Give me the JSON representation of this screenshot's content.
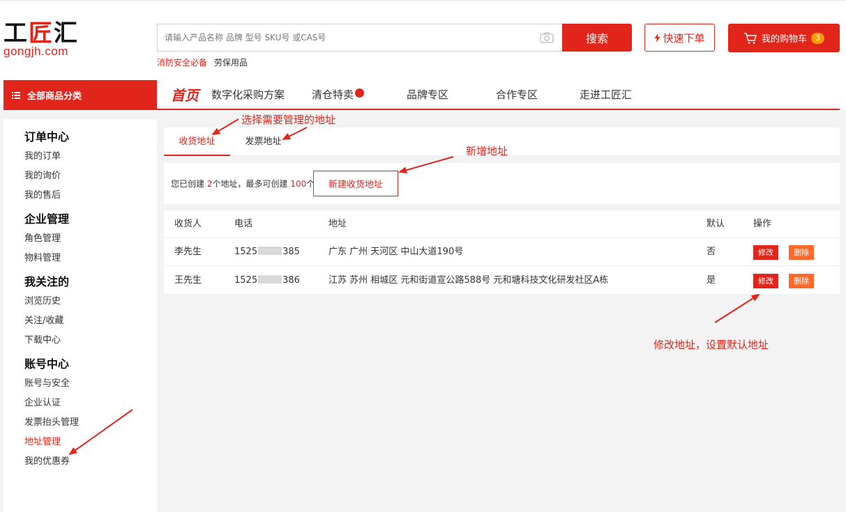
{
  "header": {
    "logo_cn_1": "工",
    "logo_cn_2": "匠",
    "logo_cn_3": "汇",
    "logo_en": "gongjh.com",
    "search_placeholder": "请输入产品名称 品牌 型号 SKU号 或CAS号",
    "search_button": "搜索",
    "quick_order": "快速下单",
    "cart_label": "我的购物车",
    "cart_count": "3",
    "hot_words": [
      "消防安全必备",
      "劳保用品"
    ]
  },
  "nav": {
    "all_categories": "全部商品分类",
    "items": [
      "首页",
      "数字化采购方案",
      "清仓特卖",
      "品牌专区",
      "合作专区",
      "走进工匠汇"
    ]
  },
  "sidebar": {
    "groups": [
      {
        "title": "订单中心",
        "items": [
          "我的订单",
          "我的询价",
          "我的售后"
        ]
      },
      {
        "title": "企业管理",
        "items": [
          "角色管理",
          "物料管理"
        ]
      },
      {
        "title": "我关注的",
        "items": [
          "浏览历史",
          "关注/收藏",
          "下载中心"
        ]
      },
      {
        "title": "账号中心",
        "items": [
          "账号与安全",
          "企业认证",
          "发票抬头管理",
          "地址管理",
          "我的优惠券"
        ]
      }
    ]
  },
  "tabs": [
    "收货地址",
    "发票地址"
  ],
  "info": {
    "prefix": "您已创建",
    "created": "2",
    "middle": "个地址，最多可创建",
    "max": "100",
    "suffix": "个",
    "new_button": "新建收货地址"
  },
  "table": {
    "headers": [
      "收货人",
      "电话",
      "地址",
      "默认",
      "操作"
    ],
    "rows": [
      {
        "name": "李先生",
        "phone_a": "1525",
        "phone_b": "385",
        "address": "广东 广州 天河区 中山大道190号",
        "default": "否",
        "edit": "修改",
        "delete": "删除"
      },
      {
        "name": "王先生",
        "phone_a": "1525",
        "phone_b": "386",
        "address": "江苏 苏州 相城区 元和街道宣公路588号 元和塘科技文化研发社区A栋",
        "default": "是",
        "edit": "修改",
        "delete": "删除"
      }
    ]
  },
  "annotations": {
    "select": "选择需要管理的地址",
    "add": "新增地址",
    "edit": "修改地址，设置默认地址"
  },
  "colors": {
    "brand": "#e1251b",
    "delete": "#ff6a2b",
    "badge": "#ff9900"
  }
}
